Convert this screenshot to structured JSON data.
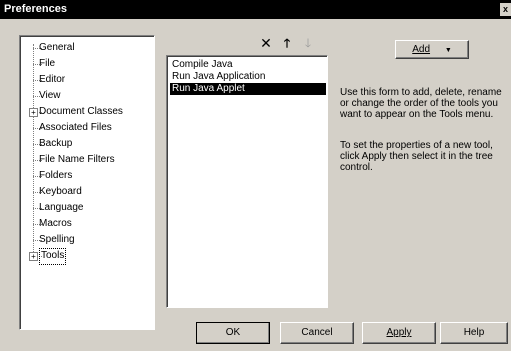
{
  "window": {
    "title": "Preferences",
    "close_glyph": "x"
  },
  "tree": {
    "items": [
      {
        "label": "General",
        "expandable": false
      },
      {
        "label": "File",
        "expandable": false
      },
      {
        "label": "Editor",
        "expandable": false
      },
      {
        "label": "View",
        "expandable": false
      },
      {
        "label": "Document Classes",
        "expandable": true
      },
      {
        "label": "Associated Files",
        "expandable": false
      },
      {
        "label": "Backup",
        "expandable": false
      },
      {
        "label": "File Name Filters",
        "expandable": false
      },
      {
        "label": "Folders",
        "expandable": false
      },
      {
        "label": "Keyboard",
        "expandable": false
      },
      {
        "label": "Language",
        "expandable": false
      },
      {
        "label": "Macros",
        "expandable": false
      },
      {
        "label": "Spelling",
        "expandable": false
      },
      {
        "label": "Tools",
        "expandable": true,
        "selected": true
      }
    ],
    "expand_glyph": "+"
  },
  "toolbar": {
    "delete_glyph": "✕",
    "up_glyph": "🡑",
    "down_glyph": "🡓"
  },
  "tools_list": {
    "items": [
      {
        "label": "Compile Java",
        "selected": false
      },
      {
        "label": "Run Java Application",
        "selected": false
      },
      {
        "label": "Run Java Applet",
        "selected": true
      }
    ]
  },
  "add_button": {
    "label": "Add",
    "arrow": "▼"
  },
  "description": {
    "para1": "Use this form to add, delete, rename or change the order of the tools you want to appear on the Tools menu.",
    "para2": "To set the properties of a new tool, click Apply then select it in the tree control."
  },
  "buttons": {
    "ok": "OK",
    "cancel": "Cancel",
    "apply": "Apply",
    "help": "Help"
  }
}
